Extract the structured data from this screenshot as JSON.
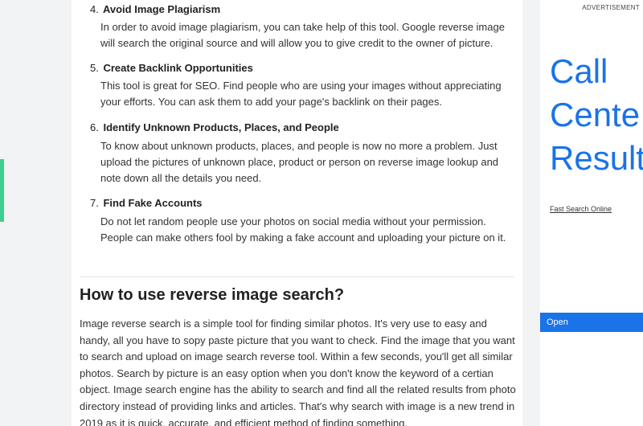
{
  "article": {
    "list": [
      {
        "number": "4.",
        "title": "Avoid Image Plagiarism",
        "desc": "In order to avoid image plagiarism, you can take help of this tool. Google reverse image will search the original source and will allow you to give credit to the owner of picture."
      },
      {
        "number": "5.",
        "title": "Create Backlink Opportunities",
        "desc": "This tool is great for SEO. Find people who are using your images without appreciating your efforts. You can ask them to add your page's backlink on their pages."
      },
      {
        "number": "6.",
        "title": "Identify Unknown Products, Places, and People",
        "desc": "To know about unknown products, places, and people is now no more a problem. Just upload the pictures of unknown place, product or person on reverse image lookup and note down all the details you need."
      },
      {
        "number": "7.",
        "title": "Find Fake Accounts",
        "desc": "Do not let random people use your photos on social media without your permission. People can make others fool by making a fake account and uploading your picture on it."
      }
    ],
    "section_heading": "How to use reverse image search?",
    "section_body": "Image reverse search is a simple tool for finding similar photos. It's very use to easy and handy, all you have to sopy paste picture that you want to check. Find the image that you want to search and upload on image search reverse tool. Within a few seconds, you'll get all similar photos. Search by picture is an easy option when you don't know the keyword of a certian object. Image search engine has the ability to search and find all the related results from photo directory instead of providing links and articles. That's why search with image is a new trend in 2019 as it is quick, accurate, and efficient method of finding something."
  },
  "ad": {
    "label": "ADVERTISEMENT",
    "headline": [
      "Call",
      "Cente",
      "Result"
    ],
    "source": "Fast Search Online",
    "watermark": "Search Online",
    "button": "Open"
  },
  "colors": {
    "accent_green": "#3ecf8e",
    "ad_blue": "#1a73e8",
    "page_bg": "#f1f3f4"
  }
}
